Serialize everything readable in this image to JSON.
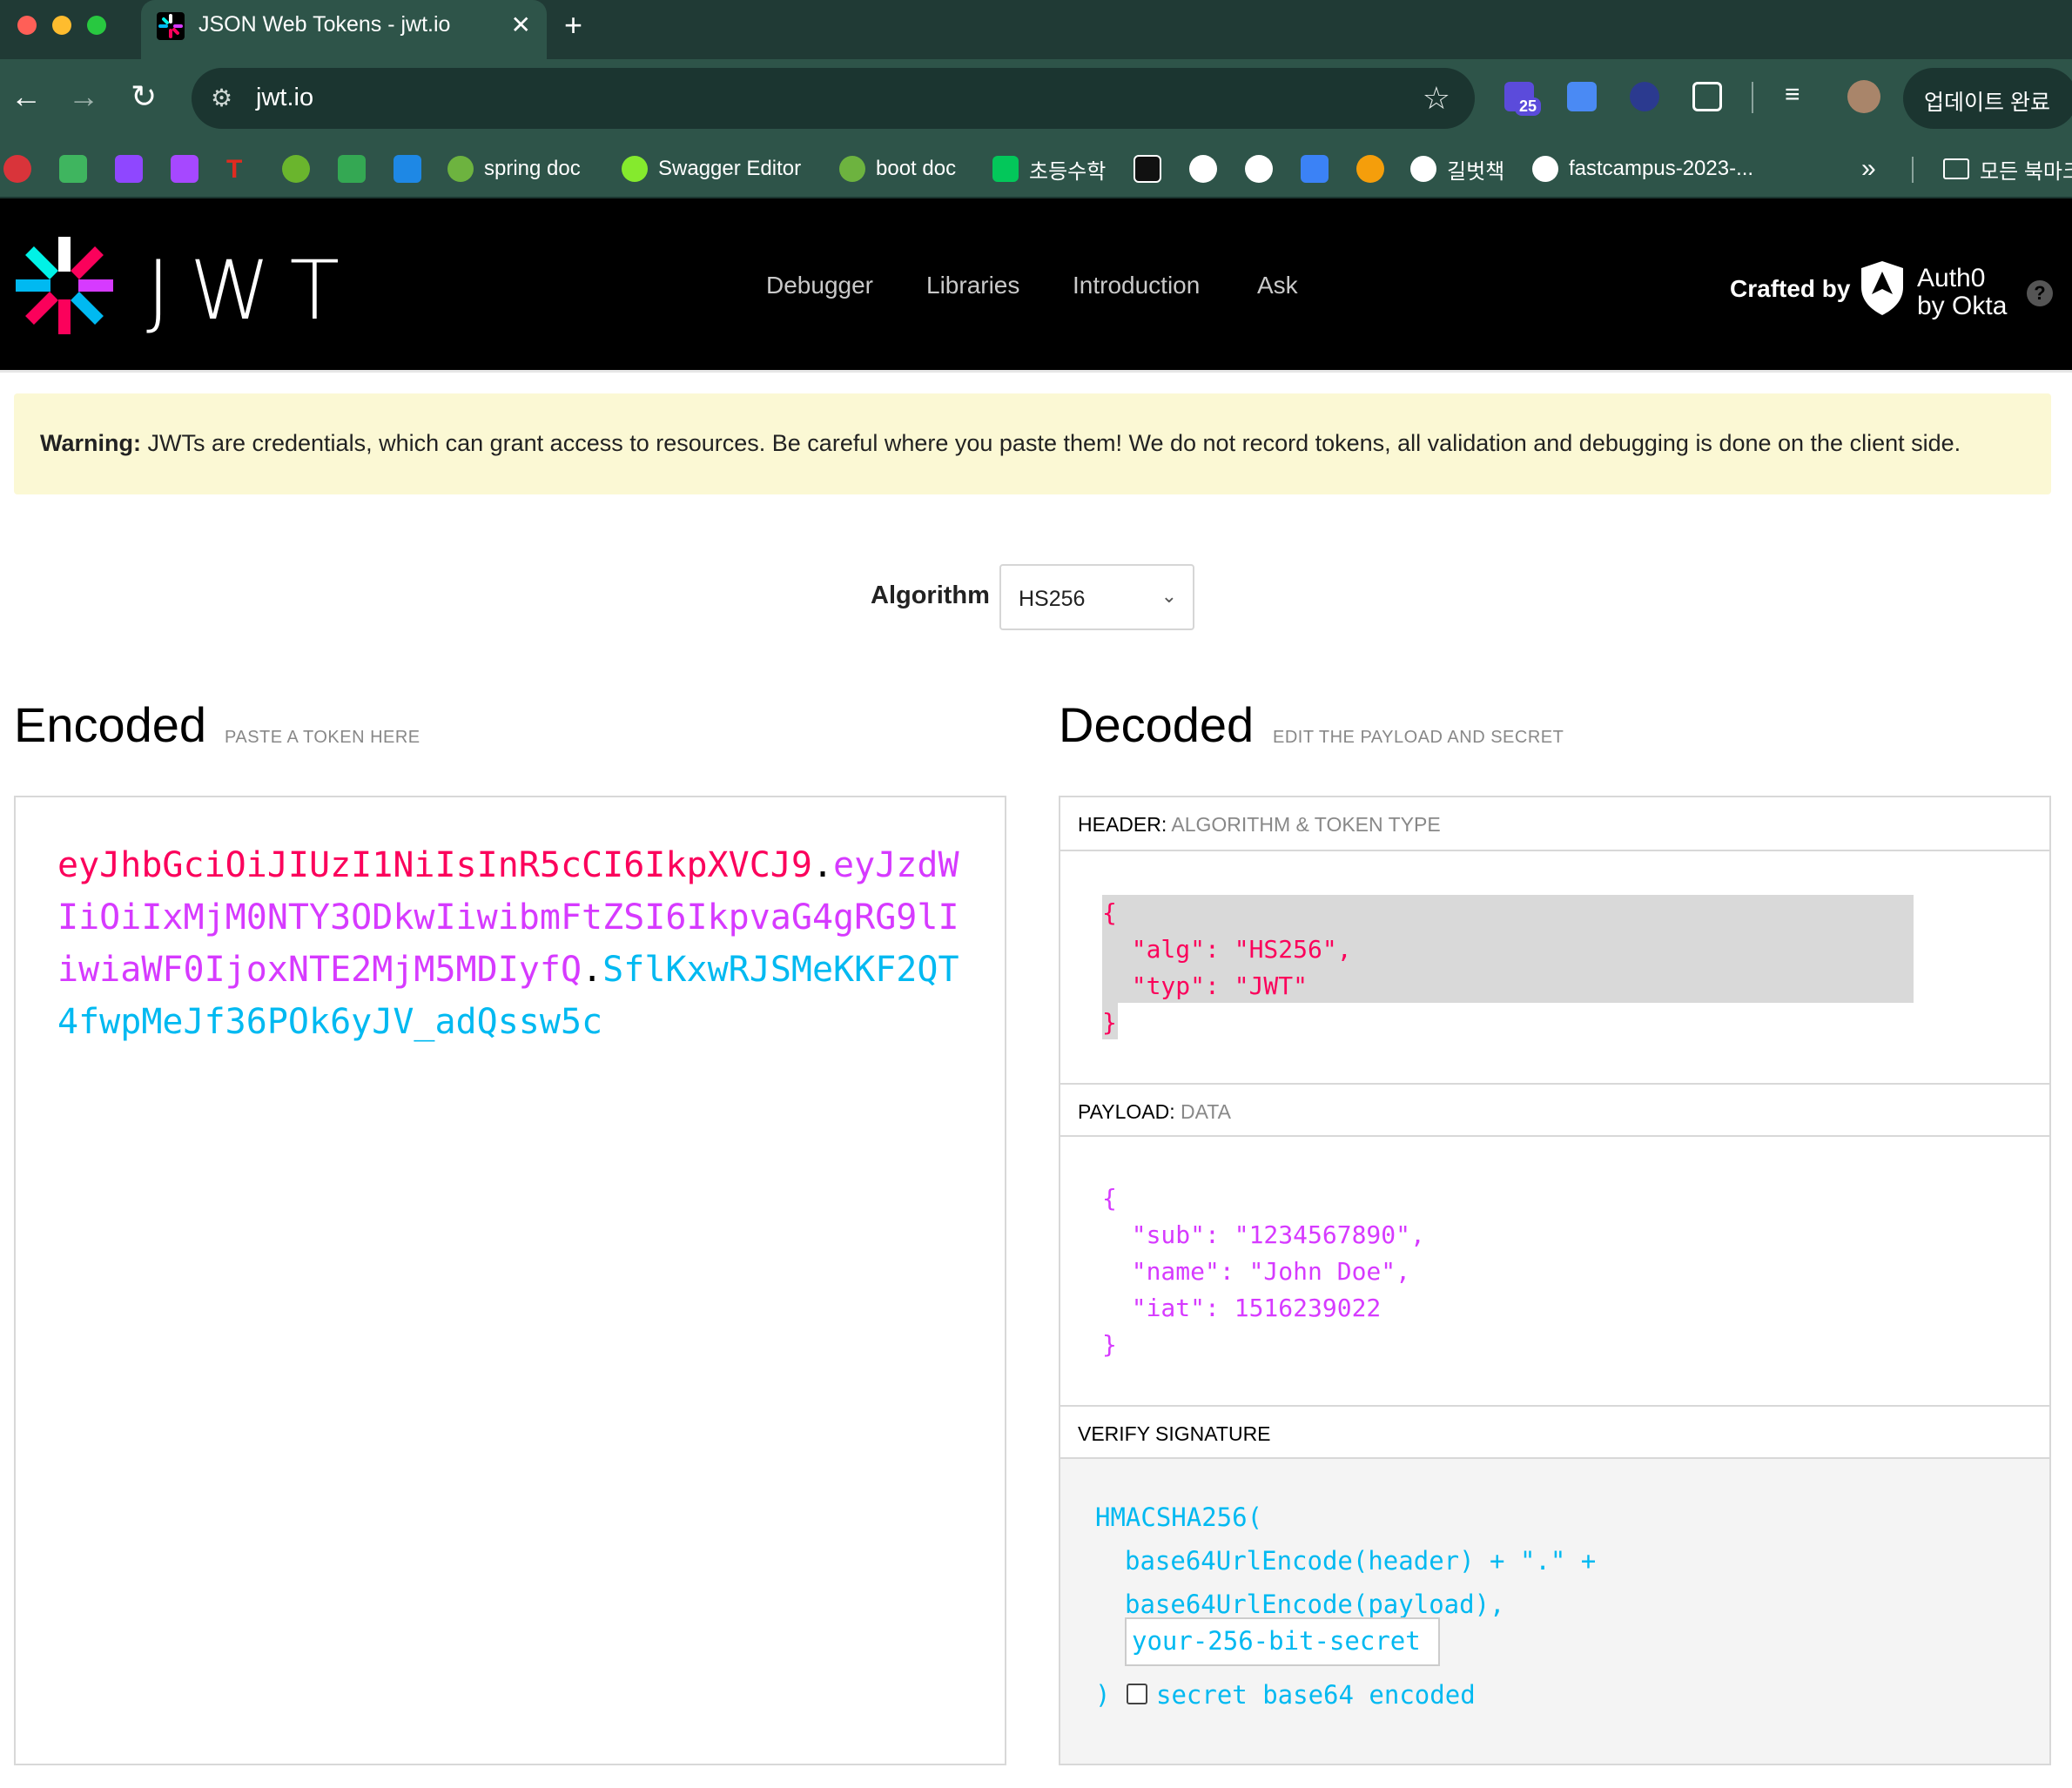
{
  "browser": {
    "tab_title": "JSON Web Tokens - jwt.io",
    "url": "jwt.io",
    "ext_badge": "25",
    "update_label": "업데이트 완료",
    "bookmarks": {
      "spring_doc": "spring doc",
      "swagger": "Swagger Editor",
      "boot_doc": "boot doc",
      "math": "초등수학",
      "gilbook": "길벗책",
      "fastcampus": "fastcampus-2023-...",
      "all_bookmarks": "모든 북마크"
    }
  },
  "site": {
    "logo_text": "JWT",
    "nav": [
      "Debugger",
      "Libraries",
      "Introduction",
      "Ask"
    ],
    "crafted_by": "Crafted by",
    "auth0_line1": "Auth0",
    "auth0_line2": "by Okta",
    "help": "?"
  },
  "warning": {
    "bold": "Warning:",
    "text": " JWTs are credentials, which can grant access to resources. Be careful where you paste them! We do not record tokens, all validation and debugging is done on the client side."
  },
  "algorithm": {
    "label": "Algorithm",
    "value": "HS256"
  },
  "encoded": {
    "title": "Encoded",
    "subtitle": "PASTE A TOKEN HERE",
    "header_part": "eyJhbGciOiJIUzI1NiIsInR5cCI6IkpXVCJ9",
    "payload_part": "eyJzdWIiOiIxMjM0NTY3ODkwIiwibmFtZSI6IkpvaG4gRG9lIiwiaWF0IjoxNTE2MjM5MDIyfQ",
    "signature_part": "SflKxwRJSMeKKF2QT4fwpMeJf36POk6yJV_adQssw5c",
    "dot": "."
  },
  "decoded": {
    "title": "Decoded",
    "subtitle": "EDIT THE PAYLOAD AND SECRET",
    "header_label": "HEADER:",
    "header_sub": "ALGORITHM & TOKEN TYPE",
    "header_json": "{\n  \"alg\": \"HS256\",\n  \"typ\": \"JWT\"\n}",
    "payload_label": "PAYLOAD:",
    "payload_sub": "DATA",
    "payload_json": "{\n  \"sub\": \"1234567890\",\n  \"name\": \"John Doe\",\n  \"iat\": 1516239022\n}",
    "verify_label": "VERIFY SIGNATURE",
    "hmac_line": "HMACSHA256(",
    "line2": "base64UrlEncode(header) + \".\" +",
    "line3": "base64UrlEncode(payload),",
    "secret_placeholder": "your-256-bit-secret",
    "close_paren": ")",
    "checkbox_label": "secret base64 encoded"
  },
  "colors": {
    "header_red": "#fb015b",
    "payload_purple": "#d63aff",
    "signature_blue": "#00b9f1"
  }
}
